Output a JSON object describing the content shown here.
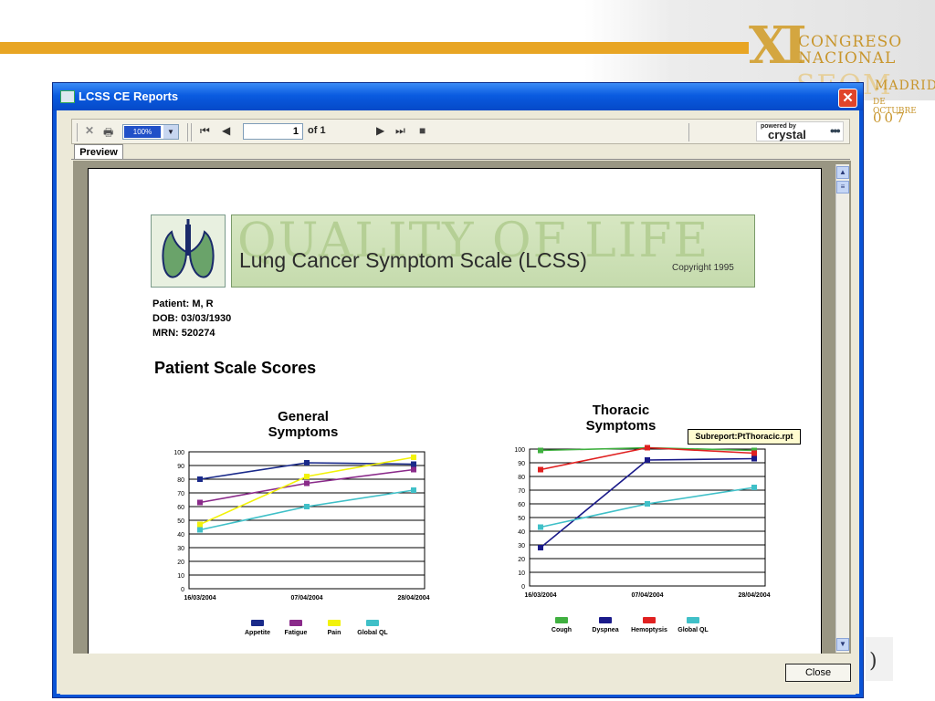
{
  "congress": {
    "roman": "XI",
    "line1": "CONGRESO",
    "line2": "NACIONAL",
    "acronym": "SEOM",
    "city": "MADRID",
    "month": "DE OCTUBRE",
    "year": "007"
  },
  "window": {
    "title": "LCSS CE Reports",
    "close_glyph": "✕"
  },
  "toolbar": {
    "zoom": "100%",
    "page_number": "1",
    "page_of": "of 1",
    "powered_by": "powered by",
    "crystal": "crystal"
  },
  "tab": {
    "label": "Preview"
  },
  "report": {
    "banner_bg": "QUALITY OF LIFE",
    "banner_title": "Lung Cancer Symptom Scale (LCSS)",
    "copyright": "Copyright 1995",
    "patient": "Patient:  M, R",
    "dob": "DOB:  03/03/1930",
    "mrn": "MRN:  520274",
    "section_title": "Patient Scale Scores",
    "subreport_tag": "Subreport:PtThoracic.rpt"
  },
  "chart_data": [
    {
      "type": "line",
      "title": "General Symptoms",
      "categories": [
        "16/03/2004",
        "07/04/2004",
        "28/04/2004"
      ],
      "ylim": [
        0,
        100
      ],
      "yticks": [
        0,
        10,
        20,
        30,
        40,
        50,
        60,
        70,
        80,
        90,
        100
      ],
      "grid": true,
      "legend": "bottom",
      "series": [
        {
          "name": "Appetite",
          "color": "#1a2a8a",
          "values": [
            80,
            92,
            91
          ]
        },
        {
          "name": "Fatigue",
          "color": "#8a2a8a",
          "values": [
            63,
            77,
            87
          ]
        },
        {
          "name": "Pain",
          "color": "#f2f20a",
          "values": [
            47,
            82,
            96
          ]
        },
        {
          "name": "Global QL",
          "color": "#40c0c8",
          "values": [
            43,
            60,
            72
          ]
        }
      ]
    },
    {
      "type": "line",
      "title": "Thoracic Symptoms",
      "categories": [
        "16/03/2004",
        "07/04/2004",
        "28/04/2004"
      ],
      "ylim": [
        0,
        100
      ],
      "yticks": [
        0,
        10,
        20,
        30,
        40,
        50,
        60,
        70,
        80,
        90,
        100
      ],
      "grid": true,
      "legend": "bottom",
      "series": [
        {
          "name": "Cough",
          "color": "#40b040",
          "values": [
            99,
            101,
            99
          ]
        },
        {
          "name": "Dyspnea",
          "color": "#1a1a8a",
          "values": [
            28,
            92,
            93
          ]
        },
        {
          "name": "Hemoptysis",
          "color": "#e02020",
          "values": [
            85,
            101,
            97
          ]
        },
        {
          "name": "Global QL",
          "color": "#40c0c8",
          "values": [
            43,
            60,
            72
          ]
        }
      ]
    }
  ]
}
